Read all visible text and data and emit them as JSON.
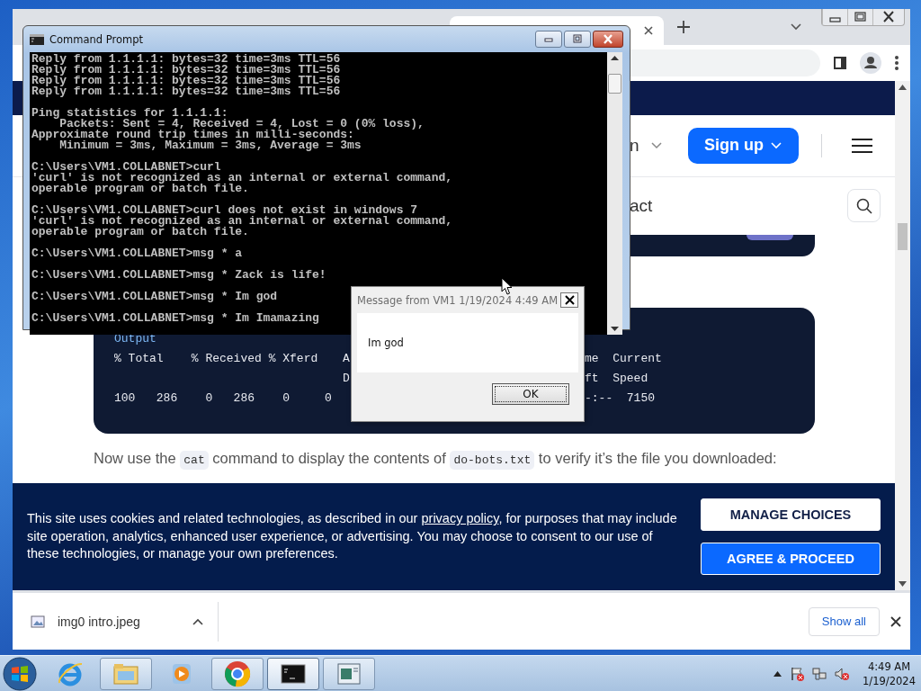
{
  "browser": {
    "header": {
      "menu_fragment": "n",
      "signup": "Sign up"
    },
    "nav": {
      "fragment": "act"
    },
    "code_output": {
      "heading": "Output",
      "rows": [
        {
          "c1": "% Total    % Received % Xferd",
          "c2": "A",
          "c3": "me  Current"
        },
        {
          "c2": "D",
          "c3": "ft  Speed"
        },
        {
          "c1": "100   286    0   286    0     0",
          "c3": "-:--  7150"
        }
      ]
    },
    "paragraph": [
      {
        "kind": "text",
        "text": "Now use the "
      },
      {
        "kind": "code",
        "text": "cat"
      },
      {
        "kind": "text",
        "text": " command to display the contents of "
      },
      {
        "kind": "code",
        "text": "do-bots.txt"
      },
      {
        "kind": "text",
        "text": " to verify it’s the file you downloaded:"
      }
    ],
    "cookie": {
      "text_before": "This site uses cookies and related technologies, as described in our ",
      "link": "privacy policy",
      "text_after": ", for purposes that may include site operation, analytics, enhanced user experience, or advertising. You may choose to consent to our use of these technologies, or manage your own preferences.",
      "buttons": [
        {
          "label": "MANAGE CHOICES",
          "kind": "secondary"
        },
        {
          "label": "AGREE & PROCEED",
          "kind": "primary"
        }
      ]
    },
    "downloads": {
      "file": "img0 intro.jpeg",
      "show_all": "Show all"
    }
  },
  "console": {
    "title": "Command Prompt",
    "blocks": [
      [
        "Reply from 1.1.1.1: bytes=32 time=3ms TTL=56",
        "Reply from 1.1.1.1: bytes=32 time=3ms TTL=56",
        "Reply from 1.1.1.1: bytes=32 time=3ms TTL=56",
        "Reply from 1.1.1.1: bytes=32 time=3ms TTL=56"
      ],
      [
        "Ping statistics for 1.1.1.1:",
        "    Packets: Sent = 4, Received = 4, Lost = 0 (0% loss),",
        "Approximate round trip times in milli-seconds:",
        "    Minimum = 3ms, Maximum = 3ms, Average = 3ms"
      ],
      [
        "C:\\Users\\VM1.COLLABNET>curl",
        "'curl' is not recognized as an internal or external command,",
        "operable program or batch file."
      ],
      [
        "C:\\Users\\VM1.COLLABNET>curl does not exist in windows 7",
        "'curl' is not recognized as an internal or external command,",
        "operable program or batch file."
      ],
      [
        "C:\\Users\\VM1.COLLABNET>msg * a"
      ],
      [
        "C:\\Users\\VM1.COLLABNET>msg * Zack is life!"
      ],
      [
        "C:\\Users\\VM1.COLLABNET>msg * Im god"
      ],
      [
        "C:\\Users\\VM1.COLLABNET>msg * Im Imamazing"
      ]
    ]
  },
  "message_box": {
    "title": "Message from VM1 1/19/2024 4:49 AM",
    "body": "Im god",
    "button": "OK"
  },
  "taskbar": {
    "apps": [
      {
        "kind": "ie",
        "running": false,
        "selected": false
      },
      {
        "kind": "explorer",
        "running": true,
        "selected": false
      },
      {
        "kind": "media",
        "running": false,
        "selected": false
      },
      {
        "kind": "chrome",
        "running": true,
        "selected": false
      },
      {
        "kind": "cmd",
        "running": true,
        "selected": true
      },
      {
        "kind": "window",
        "running": true,
        "selected": false
      }
    ],
    "time": "4:49 AM",
    "date": "1/19/2024"
  }
}
